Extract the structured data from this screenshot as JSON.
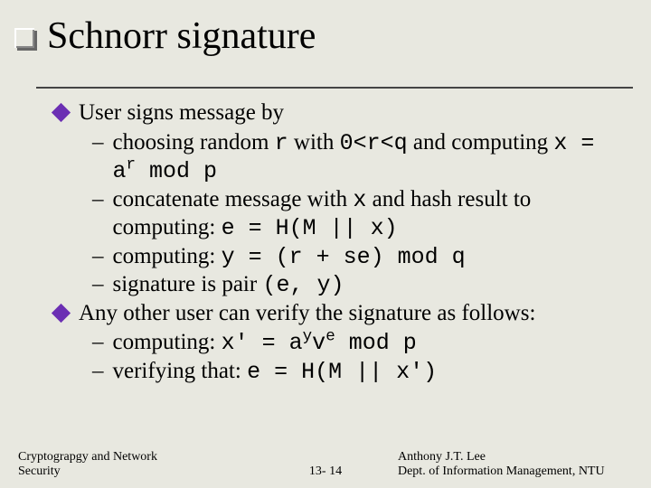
{
  "title": "Schnorr signature",
  "b1": "User signs message by",
  "s1a": "choosing random ",
  "s1b": " with ",
  "s1c": " and computing ",
  "s1_r": "r",
  "s1_cond": "0<r<q",
  "s1_x": "x =",
  "s1_eq_base": "a",
  "s1_eq_exp": "r",
  "s1_eq_rest": " mod p",
  "s2a": "concatenate message with ",
  "s2b": " and hash result to computing: ",
  "s2_x": "x",
  "s2_eq": "e = H(M || x)",
  "s3a": "computing: ",
  "s3_eq": "y = (r + se) mod q",
  "s4a": "signature is pair ",
  "s4_eq": "(e, y)",
  "b2": "Any other user can verify the signature as follows:",
  "v1a": "computing: ",
  "v1_lhs": "x' = a",
  "v1_exp1": "y",
  "v1_mid": "v",
  "v1_exp2": "e",
  "v1_rest": " mod p",
  "v2a": "verifying that: ",
  "v2_eq": "e = H(M || x')",
  "footer": {
    "left1": "Cryptograpgy and Network",
    "left2": "Security",
    "center": "13- 14",
    "right1": "Anthony J.T. Lee",
    "right2": "Dept. of Information Management, NTU"
  }
}
